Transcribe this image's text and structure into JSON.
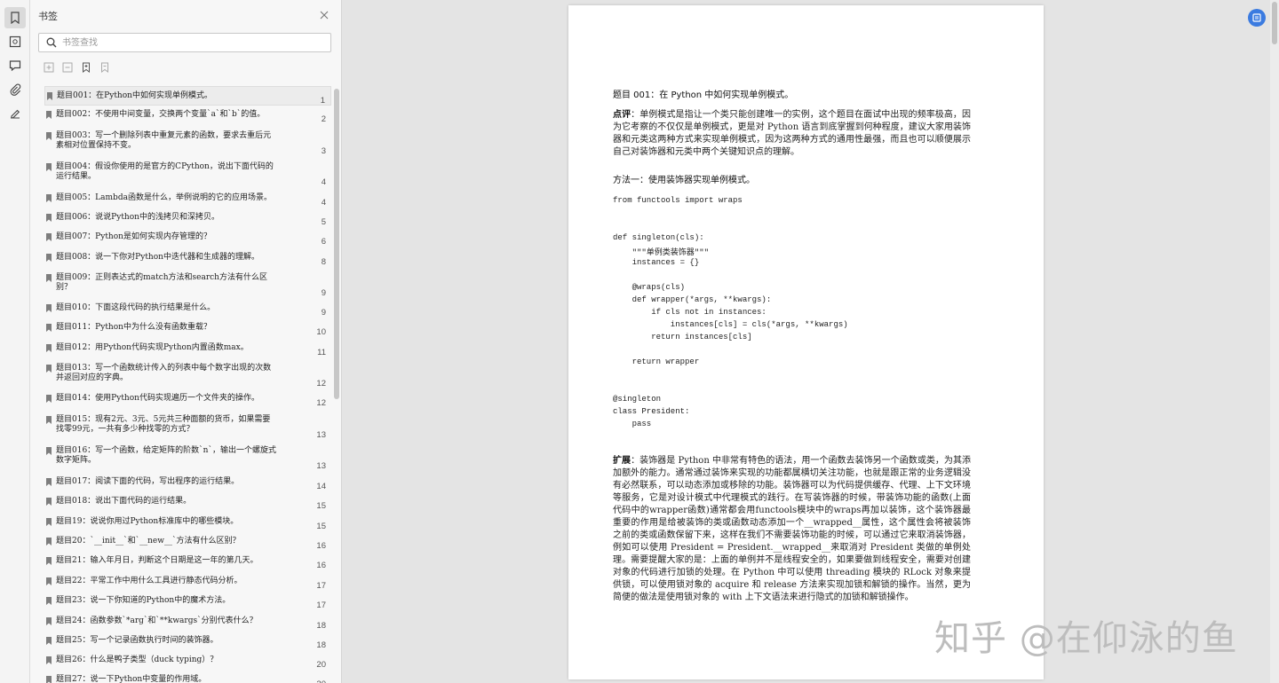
{
  "sidebar": {
    "title": "书签",
    "search_placeholder": "书签查找",
    "items": [
      {
        "label": "题目001：在Python中如何实现单例模式。",
        "page": "1"
      },
      {
        "label": "题目002：不使用中间变量，交换两个变量`a`和`b`的值。",
        "page": "2"
      },
      {
        "label": "题目003：写一个删除列表中重复元素的函数，要求去重后元素相对位置保持不变。",
        "page": "3"
      },
      {
        "label": "题目004：假设你使用的是官方的CPython，说出下面代码的运行结果。",
        "page": "4"
      },
      {
        "label": "题目005：Lambda函数是什么，举例说明的它的应用场景。",
        "page": "4"
      },
      {
        "label": "题目006：说说Python中的浅拷贝和深拷贝。",
        "page": "5"
      },
      {
        "label": "题目007：Python是如何实现内存管理的？",
        "page": "6"
      },
      {
        "label": "题目008：说一下你对Python中迭代器和生成器的理解。",
        "page": "8"
      },
      {
        "label": "题目009：正则表达式的match方法和search方法有什么区别？",
        "page": "9"
      },
      {
        "label": "题目010：下面这段代码的执行结果是什么。",
        "page": "9"
      },
      {
        "label": "题目011：Python中为什么没有函数重载？",
        "page": "10"
      },
      {
        "label": "题目012：用Python代码实现Python内置函数max。",
        "page": "11"
      },
      {
        "label": "题目013：写一个函数统计传入的列表中每个数字出现的次数并返回对应的字典。",
        "page": "12"
      },
      {
        "label": "题目014：使用Python代码实现遍历一个文件夹的操作。",
        "page": "12"
      },
      {
        "label": "题目015：现有2元、3元、5元共三种面额的货币，如果需要找零99元，一共有多少种找零的方式？",
        "page": "13"
      },
      {
        "label": "题目016：写一个函数，给定矩阵的阶数`n`，输出一个螺旋式数字矩阵。",
        "page": "13"
      },
      {
        "label": "题目017：阅读下面的代码，写出程序的运行结果。",
        "page": "14"
      },
      {
        "label": "题目018：说出下面代码的运行结果。",
        "page": "15"
      },
      {
        "label": "题目19：说说你用过Python标准库中的哪些模块。",
        "page": "15"
      },
      {
        "label": "题目20：`__init__`和`__new__`方法有什么区别？",
        "page": "16"
      },
      {
        "label": "题目21：输入年月日，判断这个日期是这一年的第几天。",
        "page": "16"
      },
      {
        "label": "题目22：平常工作中用什么工具进行静态代码分析。",
        "page": "17"
      },
      {
        "label": "题目23：说一下你知道的Python中的魔术方法。",
        "page": "17"
      },
      {
        "label": "题目24：函数参数`*arg`和`**kwargs`分别代表什么？",
        "page": "18"
      },
      {
        "label": "题目25：写一个记录函数执行时间的装饰器。",
        "page": "18"
      },
      {
        "label": "题目26：什么是鸭子类型（duck typing）？",
        "page": "20"
      },
      {
        "label": "题目27：说一下Python中变量的作用域。",
        "page": "20"
      }
    ]
  },
  "document": {
    "heading": "题目 001：在 Python 中如何实现单例模式。",
    "comment_label": "点评",
    "comment_text": "：单例模式是指让一个类只能创建唯一的实例，这个题目在面试中出现的频率极高，因为它考察的不仅仅是单例模式，更是对 Python 语言到底掌握到何种程度，建议大家用装饰器和元类这两种方式来实现单例模式，因为这两种方式的通用性最强，而且也可以顺便展示自己对装饰器和元类中两个关键知识点的理解。",
    "method1": "方法一：使用装饰器实现单例模式。",
    "code": [
      "from functools import wraps",
      "",
      "",
      "def singleton(cls):",
      "    \"\"\"单例类装饰器\"\"\"",
      "    instances = {}",
      "",
      "    @wraps(cls)",
      "    def wrapper(*args, **kwargs):",
      "        if cls not in instances:",
      "            instances[cls] = cls(*args, **kwargs)",
      "        return instances[cls]",
      "",
      "    return wrapper",
      "",
      "",
      "@singleton",
      "class President:",
      "    pass"
    ],
    "ext_label": "扩展",
    "ext_text": "：装饰器是 Python 中非常有特色的语法，用一个函数去装饰另一个函数或类，为其添加额外的能力。通常通过装饰来实现的功能都属横切关注功能，也就是跟正常的业务逻辑没有必然联系，可以动态添加或移除的功能。装饰器可以为代码提供缓存、代理、上下文环境等服务，它是对设计模式中代理模式的践行。在写装饰器的时候，带装饰功能的函数(上面代码中的wrapper函数)通常都会用functools模块中的wraps再加以装饰，这个装饰器最重要的作用是给被装饰的类或函数动态添加一个__wrapped__属性，这个属性会将被装饰之前的类或函数保留下来，这样在我们不需要装饰功能的时候，可以通过它来取消装饰器，例如可以使用 President = President.__wrapped__来取消对 President 类做的单例处理。需要提醒大家的是：上面的单例并不是线程安全的，如果要做到线程安全，需要对创建对象的代码进行加锁的处理。在 Python 中可以使用 threading 模块的 RLock 对象来提供锁，可以使用锁对象的 acquire 和 release 方法来实现加锁和解锁的操作。当然，更为简便的做法是使用锁对象的 with 上下文语法来进行隐式的加锁和解锁操作。"
  },
  "watermark": "知乎 @在仰泳的鱼"
}
